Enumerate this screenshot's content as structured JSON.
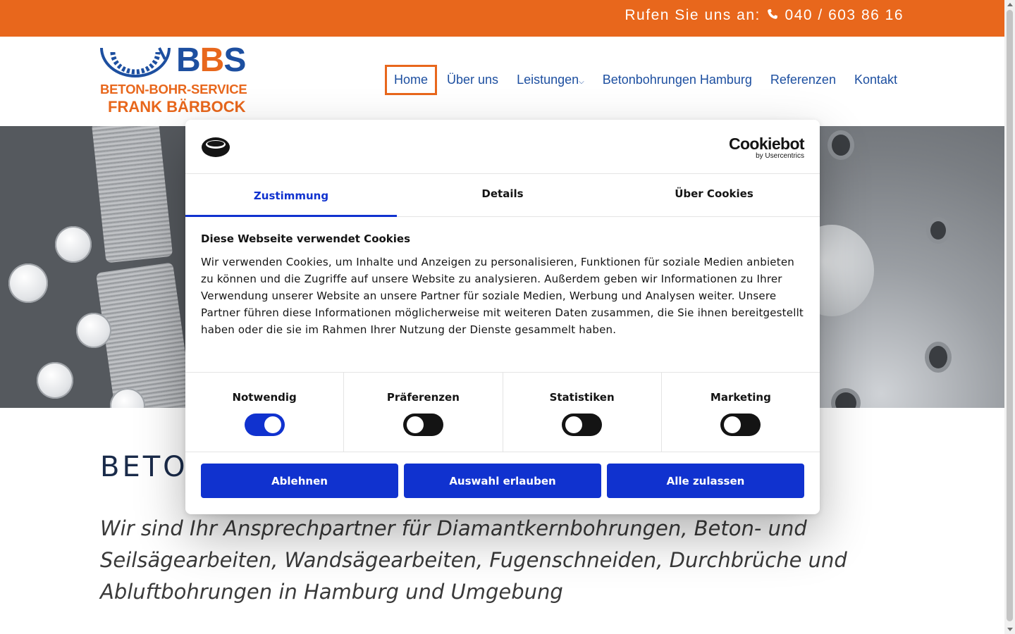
{
  "topbar": {
    "call_label": "Rufen Sie uns an:",
    "phone_icon": "phone-icon",
    "phone_number": "040 / 603 86 16",
    "bg_color": "#e8671c"
  },
  "logo": {
    "bbs_b1": "B",
    "bbs_b2": "B",
    "bbs_s": "S",
    "line1": "BETON-BOHR-SERVICE",
    "line2": "FRANK BÄRBOCK"
  },
  "nav": {
    "items": [
      "Home",
      "Über uns",
      "Leistungen",
      "Betonbohrungen Hamburg",
      "Referenzen",
      "Kontakt"
    ],
    "dropdown_icon": "chevron-down-icon",
    "active": "Home"
  },
  "main": {
    "heading": "BETON",
    "lead": "Wir sind Ihr Ansprechpartner für Diamantkernbohrungen, Beton- und Seilsägearbeiten, Wandsägearbeiten, Fugenschneiden, Durchbrüche und Abluftbohrungen in Hamburg und Umgebung"
  },
  "cookie_banner": {
    "brand_main": "Cookiebot",
    "brand_sub": "by Usercentrics",
    "tabs": [
      "Zustimmung",
      "Details",
      "Über Cookies"
    ],
    "active_tab": "Zustimmung",
    "title": "Diese Webseite verwendet Cookies",
    "text": "Wir verwenden Cookies, um Inhalte und Anzeigen zu personalisieren, Funktionen für soziale Medien anbieten zu können und die Zugriffe auf unsere Website zu analysieren. Außerdem geben wir Informationen zu Ihrer Verwendung unserer Website an unsere Partner für soziale Medien, Werbung und Analysen weiter. Unsere Partner führen diese Informationen möglicherweise mit weiteren Daten zusammen, die Sie ihnen bereitgestellt haben oder die sie im Rahmen Ihrer Nutzung der Dienste gesammelt haben.",
    "categories": [
      {
        "label": "Notwendig",
        "enabled": true
      },
      {
        "label": "Präferenzen",
        "enabled": false
      },
      {
        "label": "Statistiken",
        "enabled": false
      },
      {
        "label": "Marketing",
        "enabled": false
      }
    ],
    "buttons": {
      "decline": "Ablehnen",
      "allow_selection": "Auswahl erlauben",
      "allow_all": "Alle zulassen"
    },
    "accent_color": "#1032cf"
  }
}
